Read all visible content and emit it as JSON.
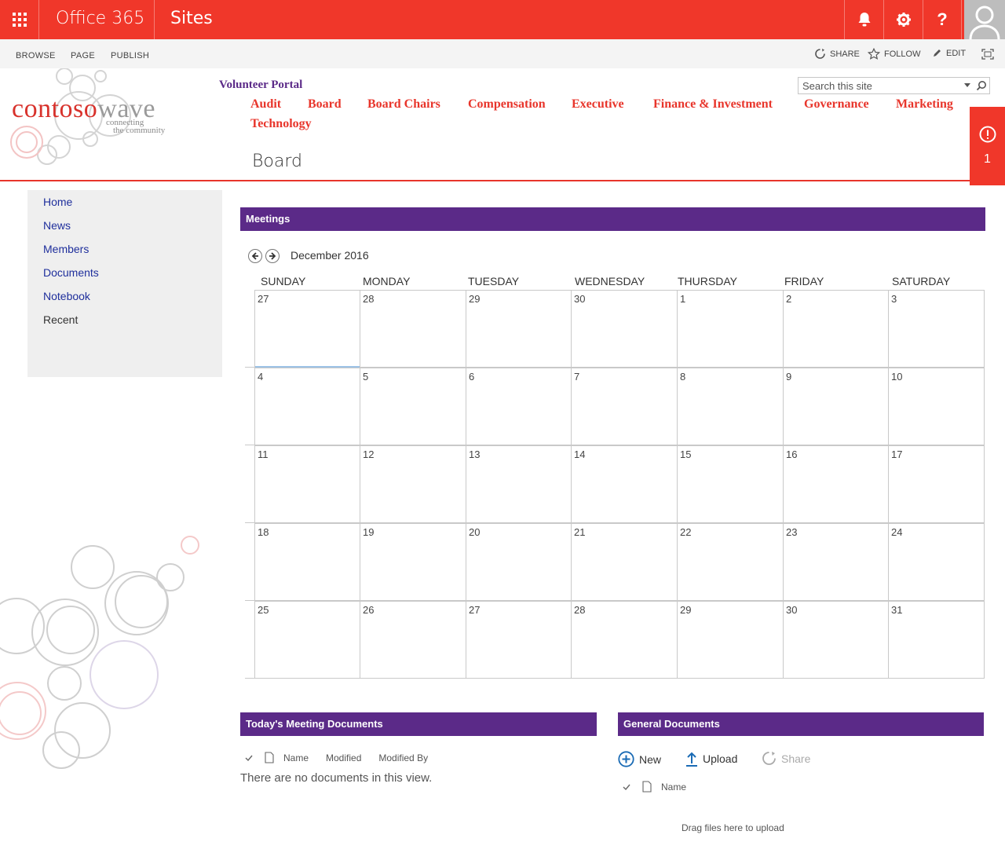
{
  "suite_bar": {
    "brand": "Office 365",
    "app": "Sites",
    "buttons": [
      {
        "icon": "bell-icon",
        "glyph": "🔔"
      },
      {
        "icon": "gear-icon",
        "glyph": "⚙"
      },
      {
        "icon": "help-icon",
        "glyph": "?"
      }
    ]
  },
  "ribbon": {
    "tabs": [
      "BROWSE",
      "PAGE",
      "PUBLISH"
    ],
    "actions": {
      "share": "SHARE",
      "follow": "FOLLOW",
      "edit": "EDIT"
    }
  },
  "logo": {
    "part1": "contoso",
    "part2": "wave",
    "tagline1": "connecting",
    "tagline2": "the community"
  },
  "header": {
    "portal": "Volunteer Portal",
    "nav": [
      "Audit",
      "Board",
      "Board Chairs",
      "Compensation",
      "Executive",
      "Finance & Investment",
      "Governance",
      "Marketing",
      "Technology"
    ]
  },
  "search": {
    "placeholder": "Search this site"
  },
  "alert": {
    "count": "1"
  },
  "page": {
    "title": "Board"
  },
  "left_nav": [
    "Home",
    "News",
    "Members",
    "Documents",
    "Notebook",
    "Recent"
  ],
  "meetings": {
    "title": "Meetings",
    "month": "December 2016",
    "days": [
      "SUNDAY",
      "MONDAY",
      "TUESDAY",
      "WEDNESDAY",
      "THURSDAY",
      "FRIDAY",
      "SATURDAY"
    ],
    "weeks": [
      [
        "27",
        "28",
        "29",
        "30",
        "1",
        "2",
        "3"
      ],
      [
        "4",
        "5",
        "6",
        "7",
        "8",
        "9",
        "10"
      ],
      [
        "11",
        "12",
        "13",
        "14",
        "15",
        "16",
        "17"
      ],
      [
        "18",
        "19",
        "20",
        "21",
        "22",
        "23",
        "24"
      ],
      [
        "25",
        "26",
        "27",
        "28",
        "29",
        "30",
        "31"
      ]
    ]
  },
  "todays_docs": {
    "title": "Today's Meeting Documents",
    "columns": [
      "Name",
      "Modified",
      "Modified By"
    ],
    "empty": "There are no documents in this view."
  },
  "general_docs": {
    "title": "General Documents",
    "commands": {
      "new": "New",
      "upload": "Upload",
      "share": "Share"
    },
    "columns": [
      "Name"
    ],
    "drag_text": "Drag files here to upload"
  },
  "colors": {
    "suite": "#f0372a",
    "header_purple": "#5b2a88",
    "nav_red": "#e8352b",
    "link_blue": "#1f2f9c"
  }
}
